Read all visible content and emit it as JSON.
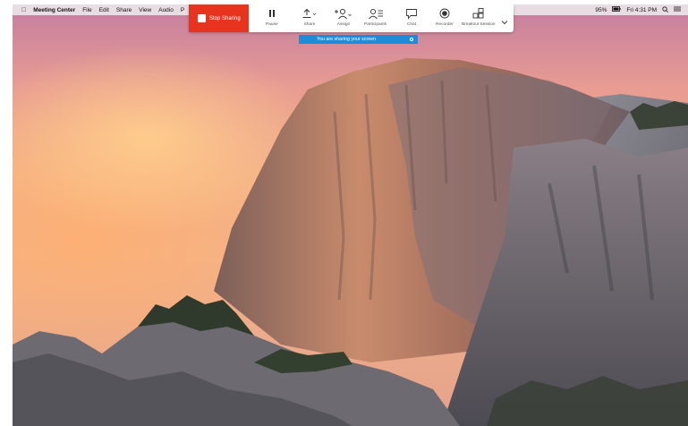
{
  "menubar": {
    "apple_icon": "apple-logo-icon",
    "app_name": "Meeting Center",
    "items": [
      "File",
      "Edit",
      "Share",
      "View",
      "Audio",
      "P"
    ],
    "battery": "95%",
    "clock": "Fri 4:31 PM"
  },
  "toolbar": {
    "stop_label": "Stop Sharing",
    "stop_color": "#e8331f",
    "pause_label": "Pause",
    "share_label": "Share",
    "assign_label": "Assign",
    "participants_label": "Participants",
    "chat_label": "Chat",
    "recorder_label": "Recorder",
    "breakout_label": "Breakout Session"
  },
  "banner": {
    "text": "You are sharing your screen",
    "color": "#1f8cd8"
  }
}
